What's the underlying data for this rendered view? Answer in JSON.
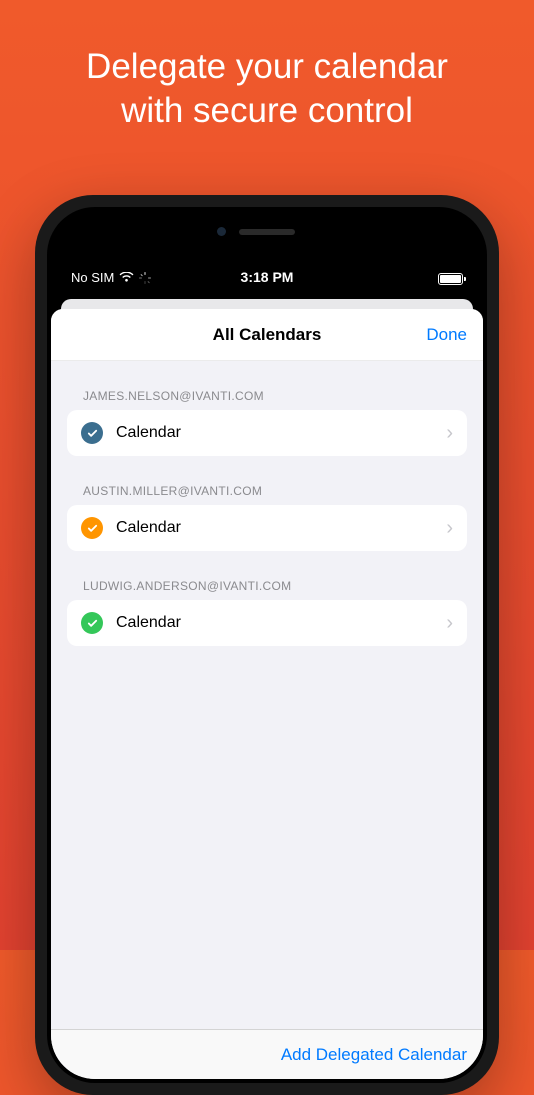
{
  "promo": {
    "headline_line1": "Delegate your calendar",
    "headline_line2": "with secure control"
  },
  "statusBar": {
    "carrier": "No SIM",
    "time": "3:18 PM"
  },
  "modal": {
    "title": "All Calendars",
    "doneLabel": "Done",
    "addButtonLabel": "Add Delegated Calendar"
  },
  "sections": [
    {
      "header": "JAMES.NELSON@IVANTI.COM",
      "item": {
        "label": "Calendar",
        "color": "blue"
      }
    },
    {
      "header": "AUSTIN.MILLER@IVANTI.COM",
      "item": {
        "label": "Calendar",
        "color": "orange"
      }
    },
    {
      "header": "LUDWIG.ANDERSON@IVANTI.COM",
      "item": {
        "label": "Calendar",
        "color": "green"
      }
    }
  ]
}
